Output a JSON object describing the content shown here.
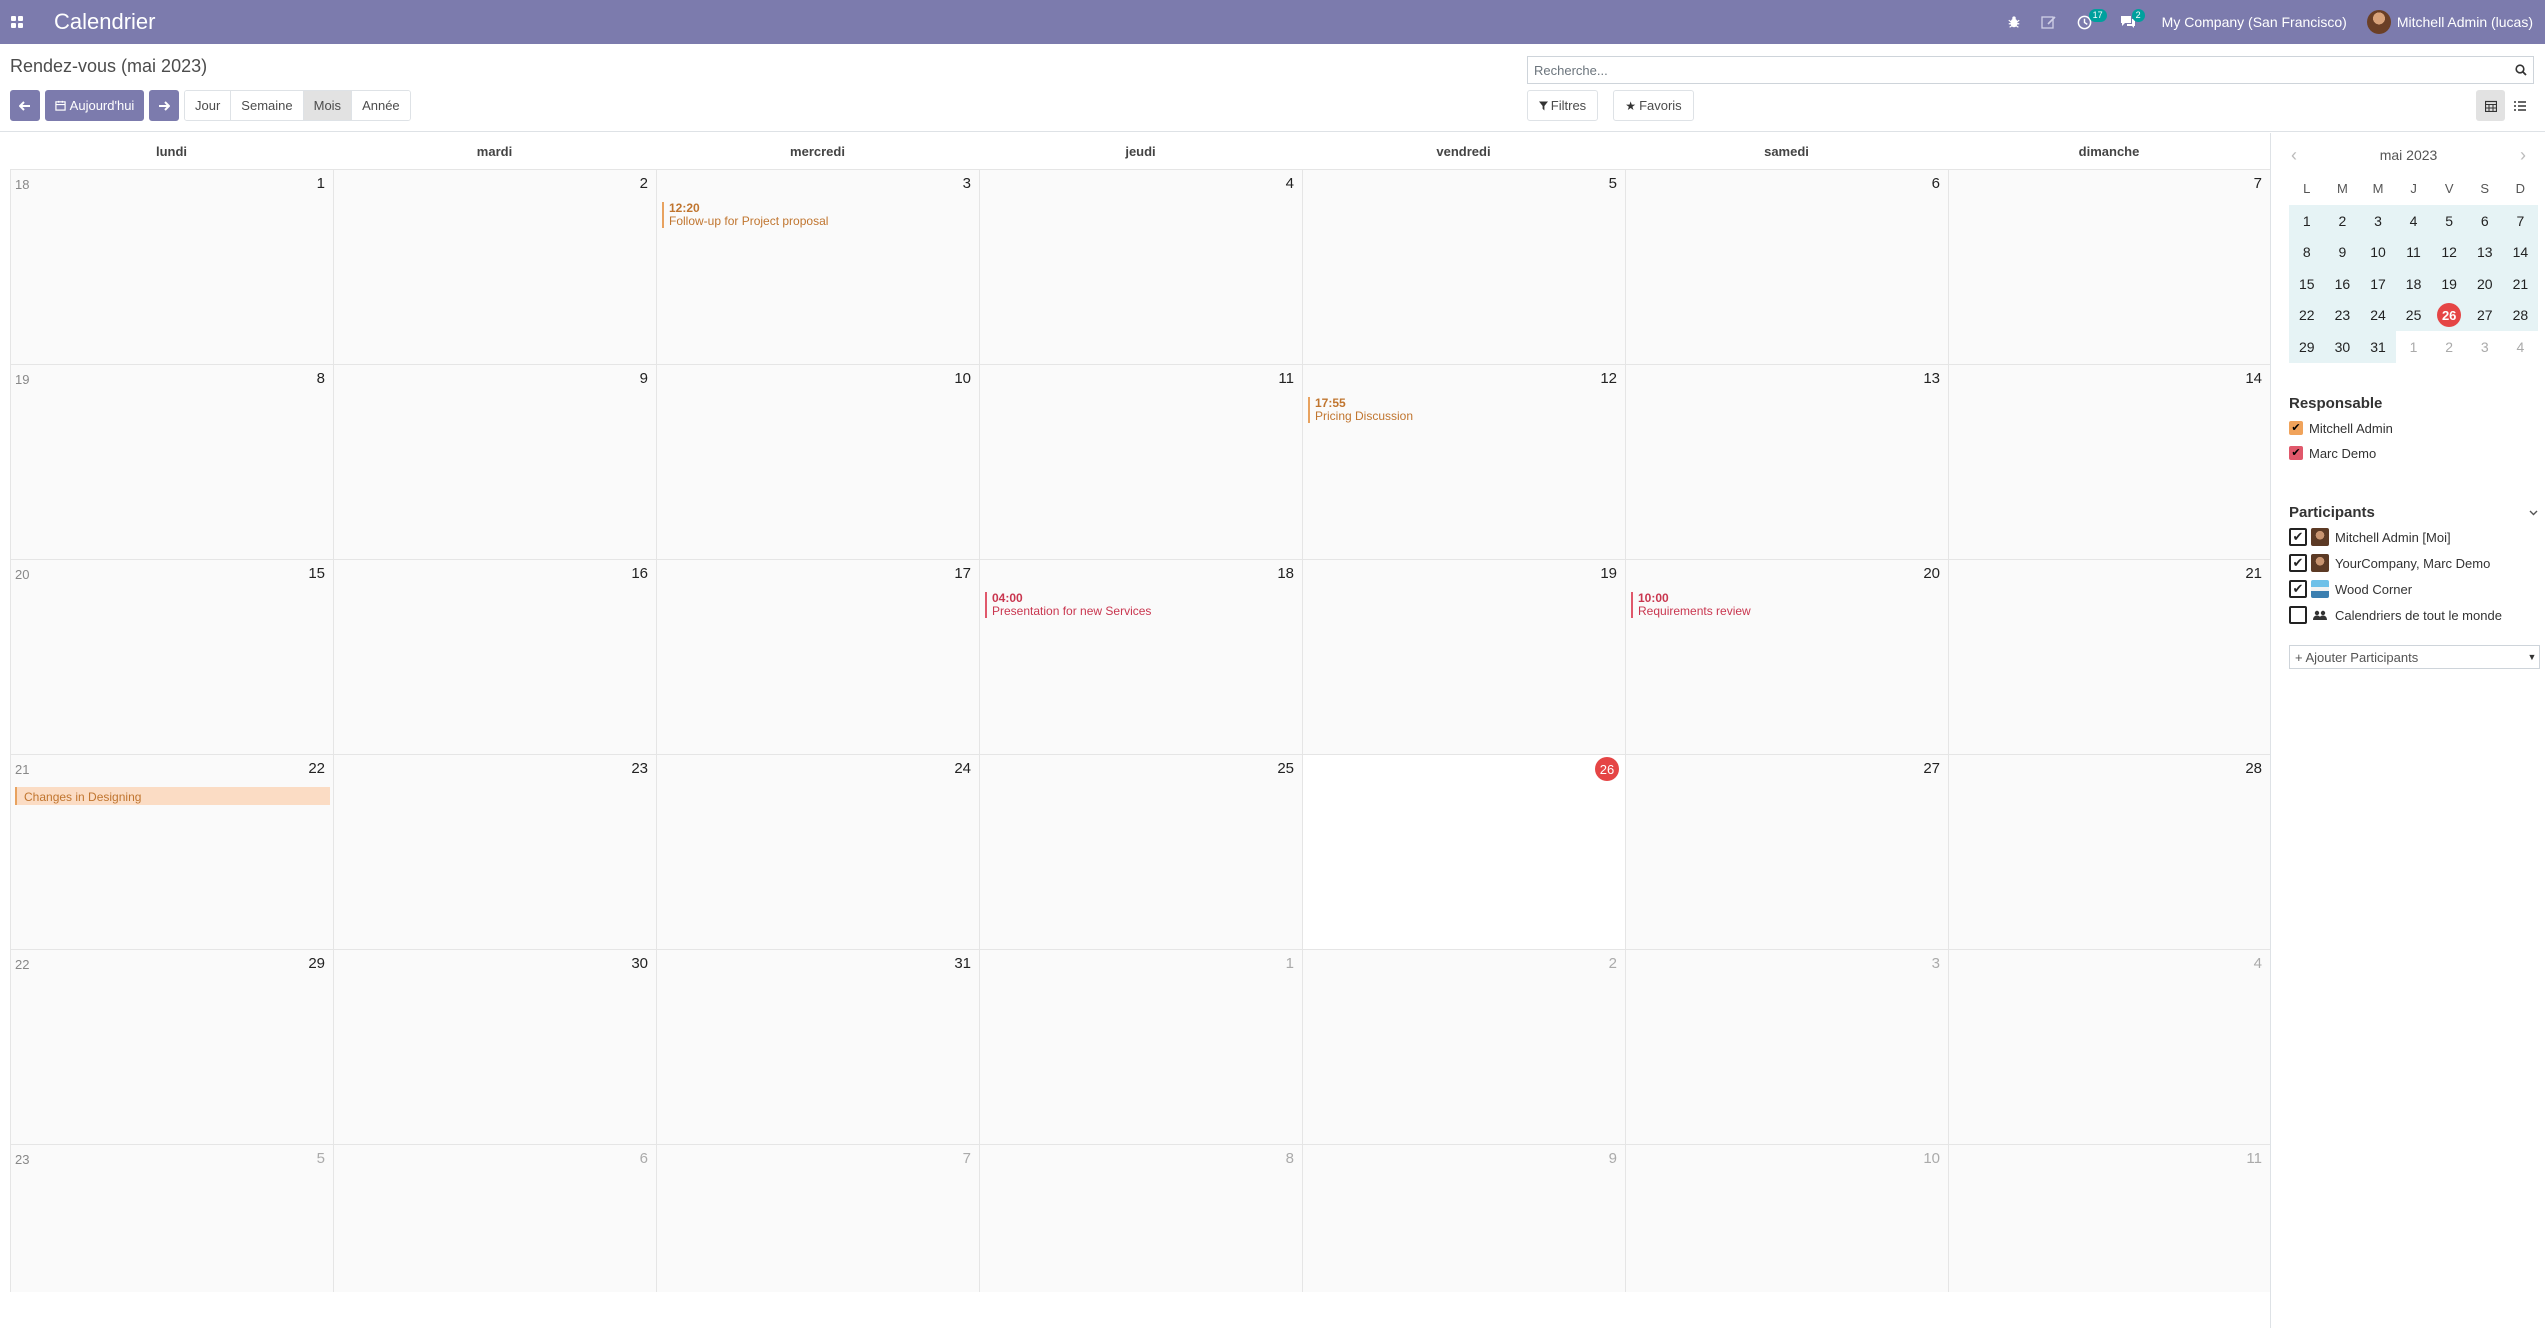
{
  "navbar": {
    "app_title": "Calendrier",
    "activity_count": "17",
    "messages_count": "2",
    "company": "My Company (San Francisco)",
    "user": "Mitchell Admin (lucas)"
  },
  "control_panel": {
    "breadcrumb": "Rendez-vous (mai 2023)",
    "search_placeholder": "Recherche...",
    "today_label": "Aujourd'hui",
    "scales": [
      "Jour",
      "Semaine",
      "Mois",
      "Année"
    ],
    "active_scale": "Mois",
    "filters_label": "Filtres",
    "favorites_label": "Favoris"
  },
  "calendar": {
    "weekdays": [
      "lundi",
      "mardi",
      "mercredi",
      "jeudi",
      "vendredi",
      "samedi",
      "dimanche"
    ],
    "weeks": [
      {
        "num": "18",
        "days": [
          "1",
          "2",
          "3",
          "4",
          "5",
          "6",
          "7"
        ]
      },
      {
        "num": "19",
        "days": [
          "8",
          "9",
          "10",
          "11",
          "12",
          "13",
          "14"
        ]
      },
      {
        "num": "20",
        "days": [
          "15",
          "16",
          "17",
          "18",
          "19",
          "20",
          "21"
        ]
      },
      {
        "num": "21",
        "days": [
          "22",
          "23",
          "24",
          "25",
          "26",
          "27",
          "28"
        ]
      },
      {
        "num": "22",
        "days": [
          "29",
          "30",
          "31",
          "1",
          "2",
          "3",
          "4"
        ]
      },
      {
        "num": "23",
        "days": [
          "5",
          "6",
          "7",
          "8",
          "9",
          "10",
          "11"
        ]
      }
    ],
    "events": [
      {
        "time": "12:20",
        "title": "Follow-up for Project proposal"
      },
      {
        "time": "17:55",
        "title": "Pricing Discussion"
      },
      {
        "time": "04:00",
        "title": "Presentation for new Services"
      },
      {
        "time": "10:00",
        "title": "Requirements review"
      }
    ],
    "allday_event": "Changes in Designing",
    "colors": {
      "orange": "#e8a25f",
      "red": "#e0586b",
      "today": "#e54545",
      "brand": "#7c7bad"
    }
  },
  "sidebar": {
    "mini_month": "mai 2023",
    "mini_dow": [
      "L",
      "M",
      "M",
      "J",
      "V",
      "S",
      "D"
    ],
    "mini_days": [
      "1",
      "2",
      "3",
      "4",
      "5",
      "6",
      "7",
      "8",
      "9",
      "10",
      "11",
      "12",
      "13",
      "14",
      "15",
      "16",
      "17",
      "18",
      "19",
      "20",
      "21",
      "22",
      "23",
      "24",
      "25",
      "26",
      "27",
      "28",
      "29",
      "30",
      "31",
      "1",
      "2",
      "3",
      "4"
    ],
    "responsable_title": "Responsable",
    "responsables": [
      "Mitchell Admin",
      "Marc Demo"
    ],
    "participants_title": "Participants",
    "participants": [
      "Mitchell Admin [Moi]",
      "YourCompany, Marc Demo",
      "Wood Corner",
      "Calendriers de tout le monde"
    ],
    "add_participants_placeholder": "+ Ajouter Participants"
  }
}
